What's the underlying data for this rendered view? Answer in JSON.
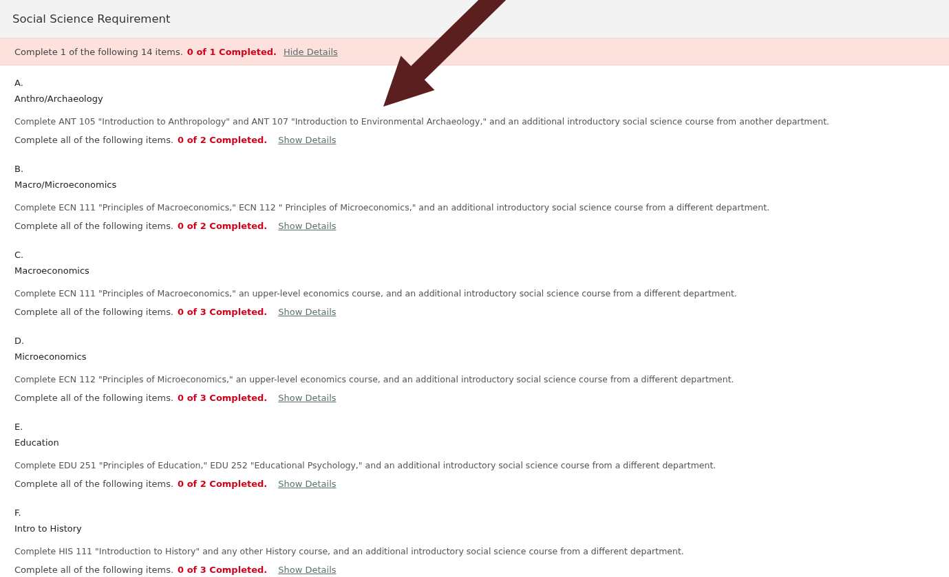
{
  "section": {
    "title": "Social Science Requirement"
  },
  "summary": {
    "text": "Complete 1 of the following 14 items.",
    "completed": "0 of 1 Completed.",
    "link": "Hide Details"
  },
  "items": [
    {
      "letter": "A.",
      "title": "Anthro/Archaeology",
      "description": "Complete ANT 105 \"Introduction to Anthropology\" and ANT 107 \"Introduction to Environmental Archaeology,\" and an additional introductory social science course from another department.",
      "rule": "Complete all of the following items.",
      "completed": "0 of 2 Completed.",
      "link": "Show Details"
    },
    {
      "letter": "B.",
      "title": "Macro/Microeconomics",
      "description": "Complete ECN 111 \"Principles of Macroeconomics,\" ECN 112 \" Principles of Microeconomics,\" and an additional introductory social science course from a different department.",
      "rule": "Complete all of the following items.",
      "completed": "0 of 2 Completed.",
      "link": "Show Details"
    },
    {
      "letter": "C.",
      "title": "Macroeconomics",
      "description": "Complete ECN 111 \"Principles of Macroeconomics,\" an upper-level economics course, and an additional introductory social science course from a different department.",
      "rule": "Complete all of the following items.",
      "completed": "0 of 3 Completed.",
      "link": "Show Details"
    },
    {
      "letter": "D.",
      "title": "Microeconomics",
      "description": "Complete ECN 112 \"Principles of Microeconomics,\" an upper-level economics course, and an additional introductory social science course from a different department.",
      "rule": "Complete all of the following items.",
      "completed": "0 of 3 Completed.",
      "link": "Show Details"
    },
    {
      "letter": "E.",
      "title": "Education",
      "description": "Complete EDU 251 \"Principles of Education,\" EDU 252 \"Educational Psychology,\" and an additional introductory social science course from a different department.",
      "rule": "Complete all of the following items.",
      "completed": "0 of 2 Completed.",
      "link": "Show Details"
    },
    {
      "letter": "F.",
      "title": "Intro to History",
      "description": "Complete HIS 111 \"Introduction to History\" and any other History course, and an additional introductory social science course from a different department.",
      "rule": "Complete all of the following items.",
      "completed": "0 of 3 Completed.",
      "link": "Show Details"
    }
  ]
}
